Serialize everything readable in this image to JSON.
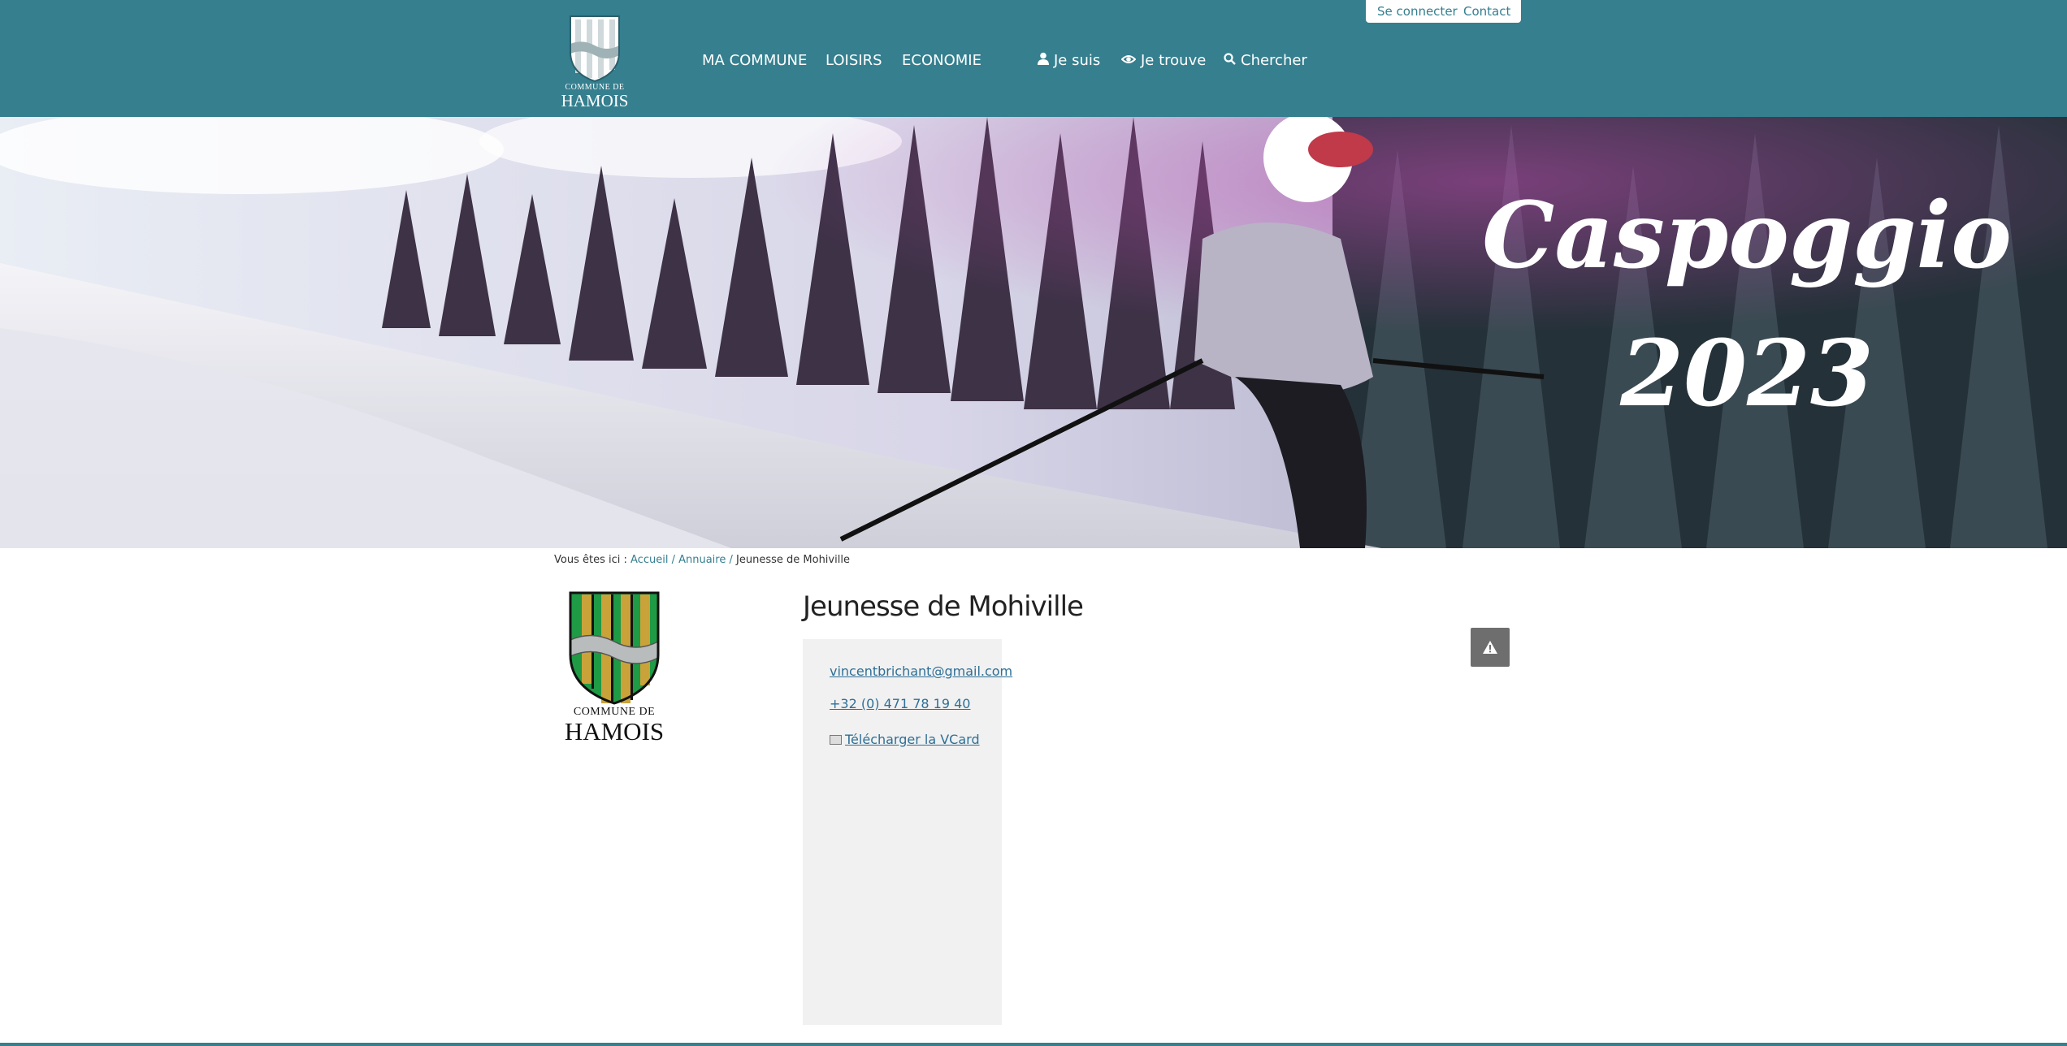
{
  "header": {
    "logo": {
      "commune_text": "COMMUNE DE",
      "name_text": "HAMOIS"
    },
    "nav": {
      "ma_commune": "MA COMMUNE",
      "loisirs": "LOISIRS",
      "economie": "ECONOMIE",
      "je_suis": "Je suis",
      "je_trouve": "Je trouve",
      "chercher": "Chercher"
    },
    "top_links": {
      "login": "Se connecter",
      "contact": "Contact"
    }
  },
  "banner": {
    "line1": "Caspoggio",
    "line2": "2023"
  },
  "breadcrumb": {
    "prefix": "Vous êtes ici :",
    "items": [
      "Accueil",
      "Annuaire"
    ],
    "separator": "/",
    "current": "Jeunesse de Mohiville"
  },
  "entry": {
    "logo": {
      "commune_text": "COMMUNE DE",
      "name_text": "HAMOIS"
    },
    "title": "Jeunesse de Mohiville",
    "email": "vincentbrichant@gmail.com",
    "phone": "+32 (0) 471 78 19 40",
    "vcard_label": "Télécharger la VCard"
  },
  "colors": {
    "brand": "#357f8f",
    "card_bg": "#f1f1f1",
    "link": "#2e6f96",
    "shield_green": "#1f9a45",
    "shield_gold": "#c9a33a"
  },
  "icons": {
    "je_suis": "user-icon",
    "je_trouve": "eye-icon",
    "chercher": "search-icon",
    "vcard": "vcard-icon",
    "report": "warning-icon"
  }
}
